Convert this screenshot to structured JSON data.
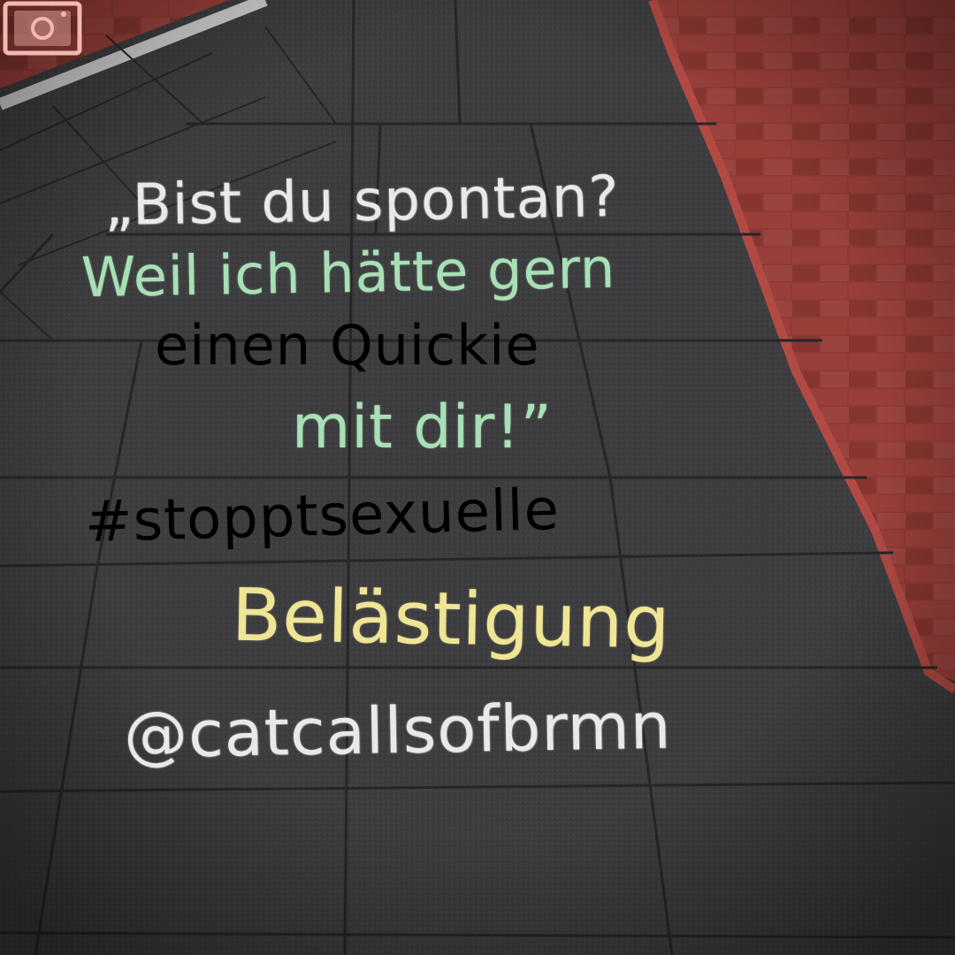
{
  "chalk": {
    "line1": "„Bist du spontan?",
    "line2": "Weil ich hätte gern",
    "line3_start": "einen ",
    "line3_accent": "Quickie",
    "line4": "mit dir!”",
    "hashtag_part1": "#stoppt",
    "hashtag_part2": "sexuelle",
    "line6": "Belästigung",
    "handle": "@catcallsofbrmn"
  },
  "colors": {
    "chalk_white": "#e9e9ea",
    "chalk_green": "#a9dfb6",
    "chalk_pink": "#f1b8b0",
    "chalk_yellow": "#efe595",
    "paving": "#3a3a3b",
    "brick": "#8e3a36"
  },
  "icons": {
    "instagram": "instagram-icon"
  }
}
